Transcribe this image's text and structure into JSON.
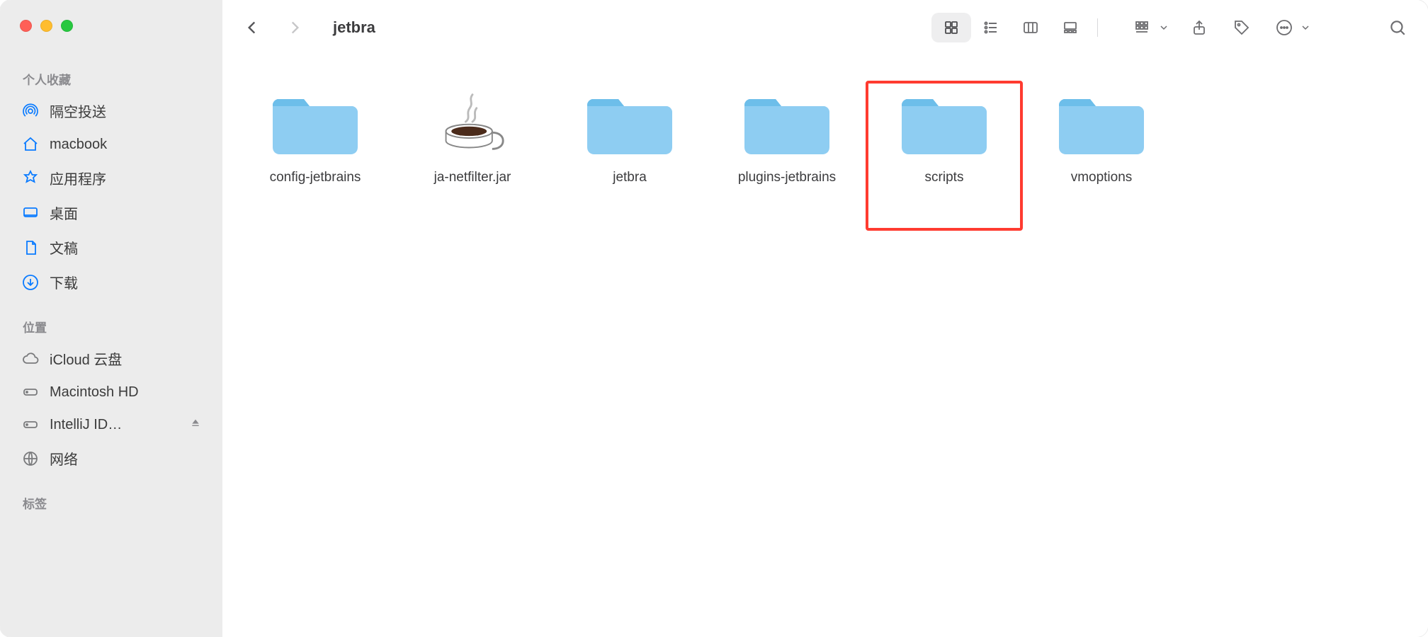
{
  "window": {
    "title": "jetbra"
  },
  "sidebar": {
    "sections": [
      {
        "title": "个人收藏",
        "items": [
          {
            "icon": "airdrop-icon",
            "label": "隔空投送"
          },
          {
            "icon": "home-icon",
            "label": "macbook"
          },
          {
            "icon": "applications-icon",
            "label": "应用程序"
          },
          {
            "icon": "desktop-icon",
            "label": "桌面"
          },
          {
            "icon": "documents-icon",
            "label": "文稿"
          },
          {
            "icon": "downloads-icon",
            "label": "下载"
          }
        ]
      },
      {
        "title": "位置",
        "items": [
          {
            "icon": "icloud-icon",
            "label": "iCloud 云盘",
            "gray": true
          },
          {
            "icon": "disk-icon",
            "label": "Macintosh HD",
            "gray": true
          },
          {
            "icon": "disk-icon",
            "label": "IntelliJ ID…",
            "gray": true,
            "eject": true
          },
          {
            "icon": "network-icon",
            "label": "网络",
            "gray": true
          }
        ]
      },
      {
        "title": "标签",
        "items": []
      }
    ]
  },
  "content": {
    "items": [
      {
        "name": "config-jetbrains",
        "type": "folder"
      },
      {
        "name": "ja-netfilter.jar",
        "type": "jar"
      },
      {
        "name": "jetbra",
        "type": "folder"
      },
      {
        "name": "plugins-jetbrains",
        "type": "folder"
      },
      {
        "name": "scripts",
        "type": "folder",
        "highlight": true
      },
      {
        "name": "vmoptions",
        "type": "folder"
      }
    ]
  }
}
